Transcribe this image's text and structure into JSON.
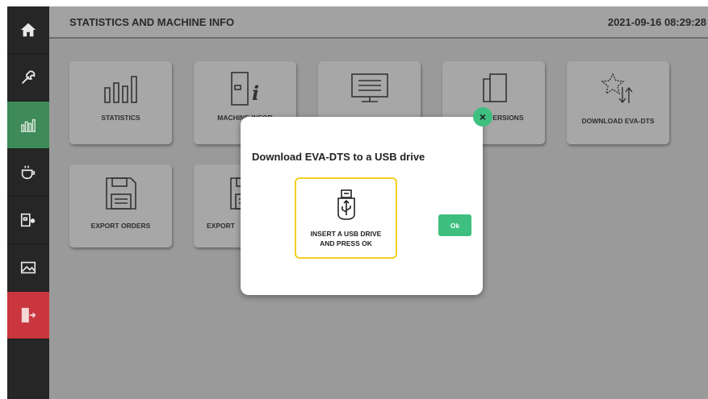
{
  "header": {
    "title": "STATISTICS AND MACHINE INFO",
    "datetime": "2021-09-16 08:29:28"
  },
  "sidebar": {
    "items": [
      {
        "name": "home-icon"
      },
      {
        "name": "wrench-icon"
      },
      {
        "name": "statistics-icon",
        "active": true
      },
      {
        "name": "coffee-cup-icon"
      },
      {
        "name": "machine-settings-icon"
      },
      {
        "name": "image-icon"
      },
      {
        "name": "exit-icon"
      }
    ],
    "colors": {
      "active": "#3e8a58",
      "exit": "#c9363d",
      "default": "#262626"
    }
  },
  "tiles": [
    {
      "label": "STATISTICS",
      "icon": "bar-chart-icon"
    },
    {
      "label": "MACHINE INFOR",
      "icon": "machine-info-icon"
    },
    {
      "label": "",
      "icon": "monitor-icon"
    },
    {
      "label": "ERSIONS",
      "icon": "versions-icon"
    },
    {
      "label": "DOWNLOAD EVA-DTS",
      "icon": "download-star-icon"
    },
    {
      "label": "EXPORT ORDERS",
      "icon": "floppy-disk-icon"
    },
    {
      "label": "EXPORT",
      "icon": "floppy-disk-icon"
    }
  ],
  "modal": {
    "title": "Download EVA-DTS to a USB drive",
    "usb_card_label_line1": "INSERT A USB DRIVE",
    "usb_card_label_line2": "AND PRESS OK",
    "ok_label": "Ok",
    "close_glyph": "×"
  },
  "colors": {
    "accent_green": "#3fbf7f",
    "highlight_yellow": "#f2cf24"
  }
}
